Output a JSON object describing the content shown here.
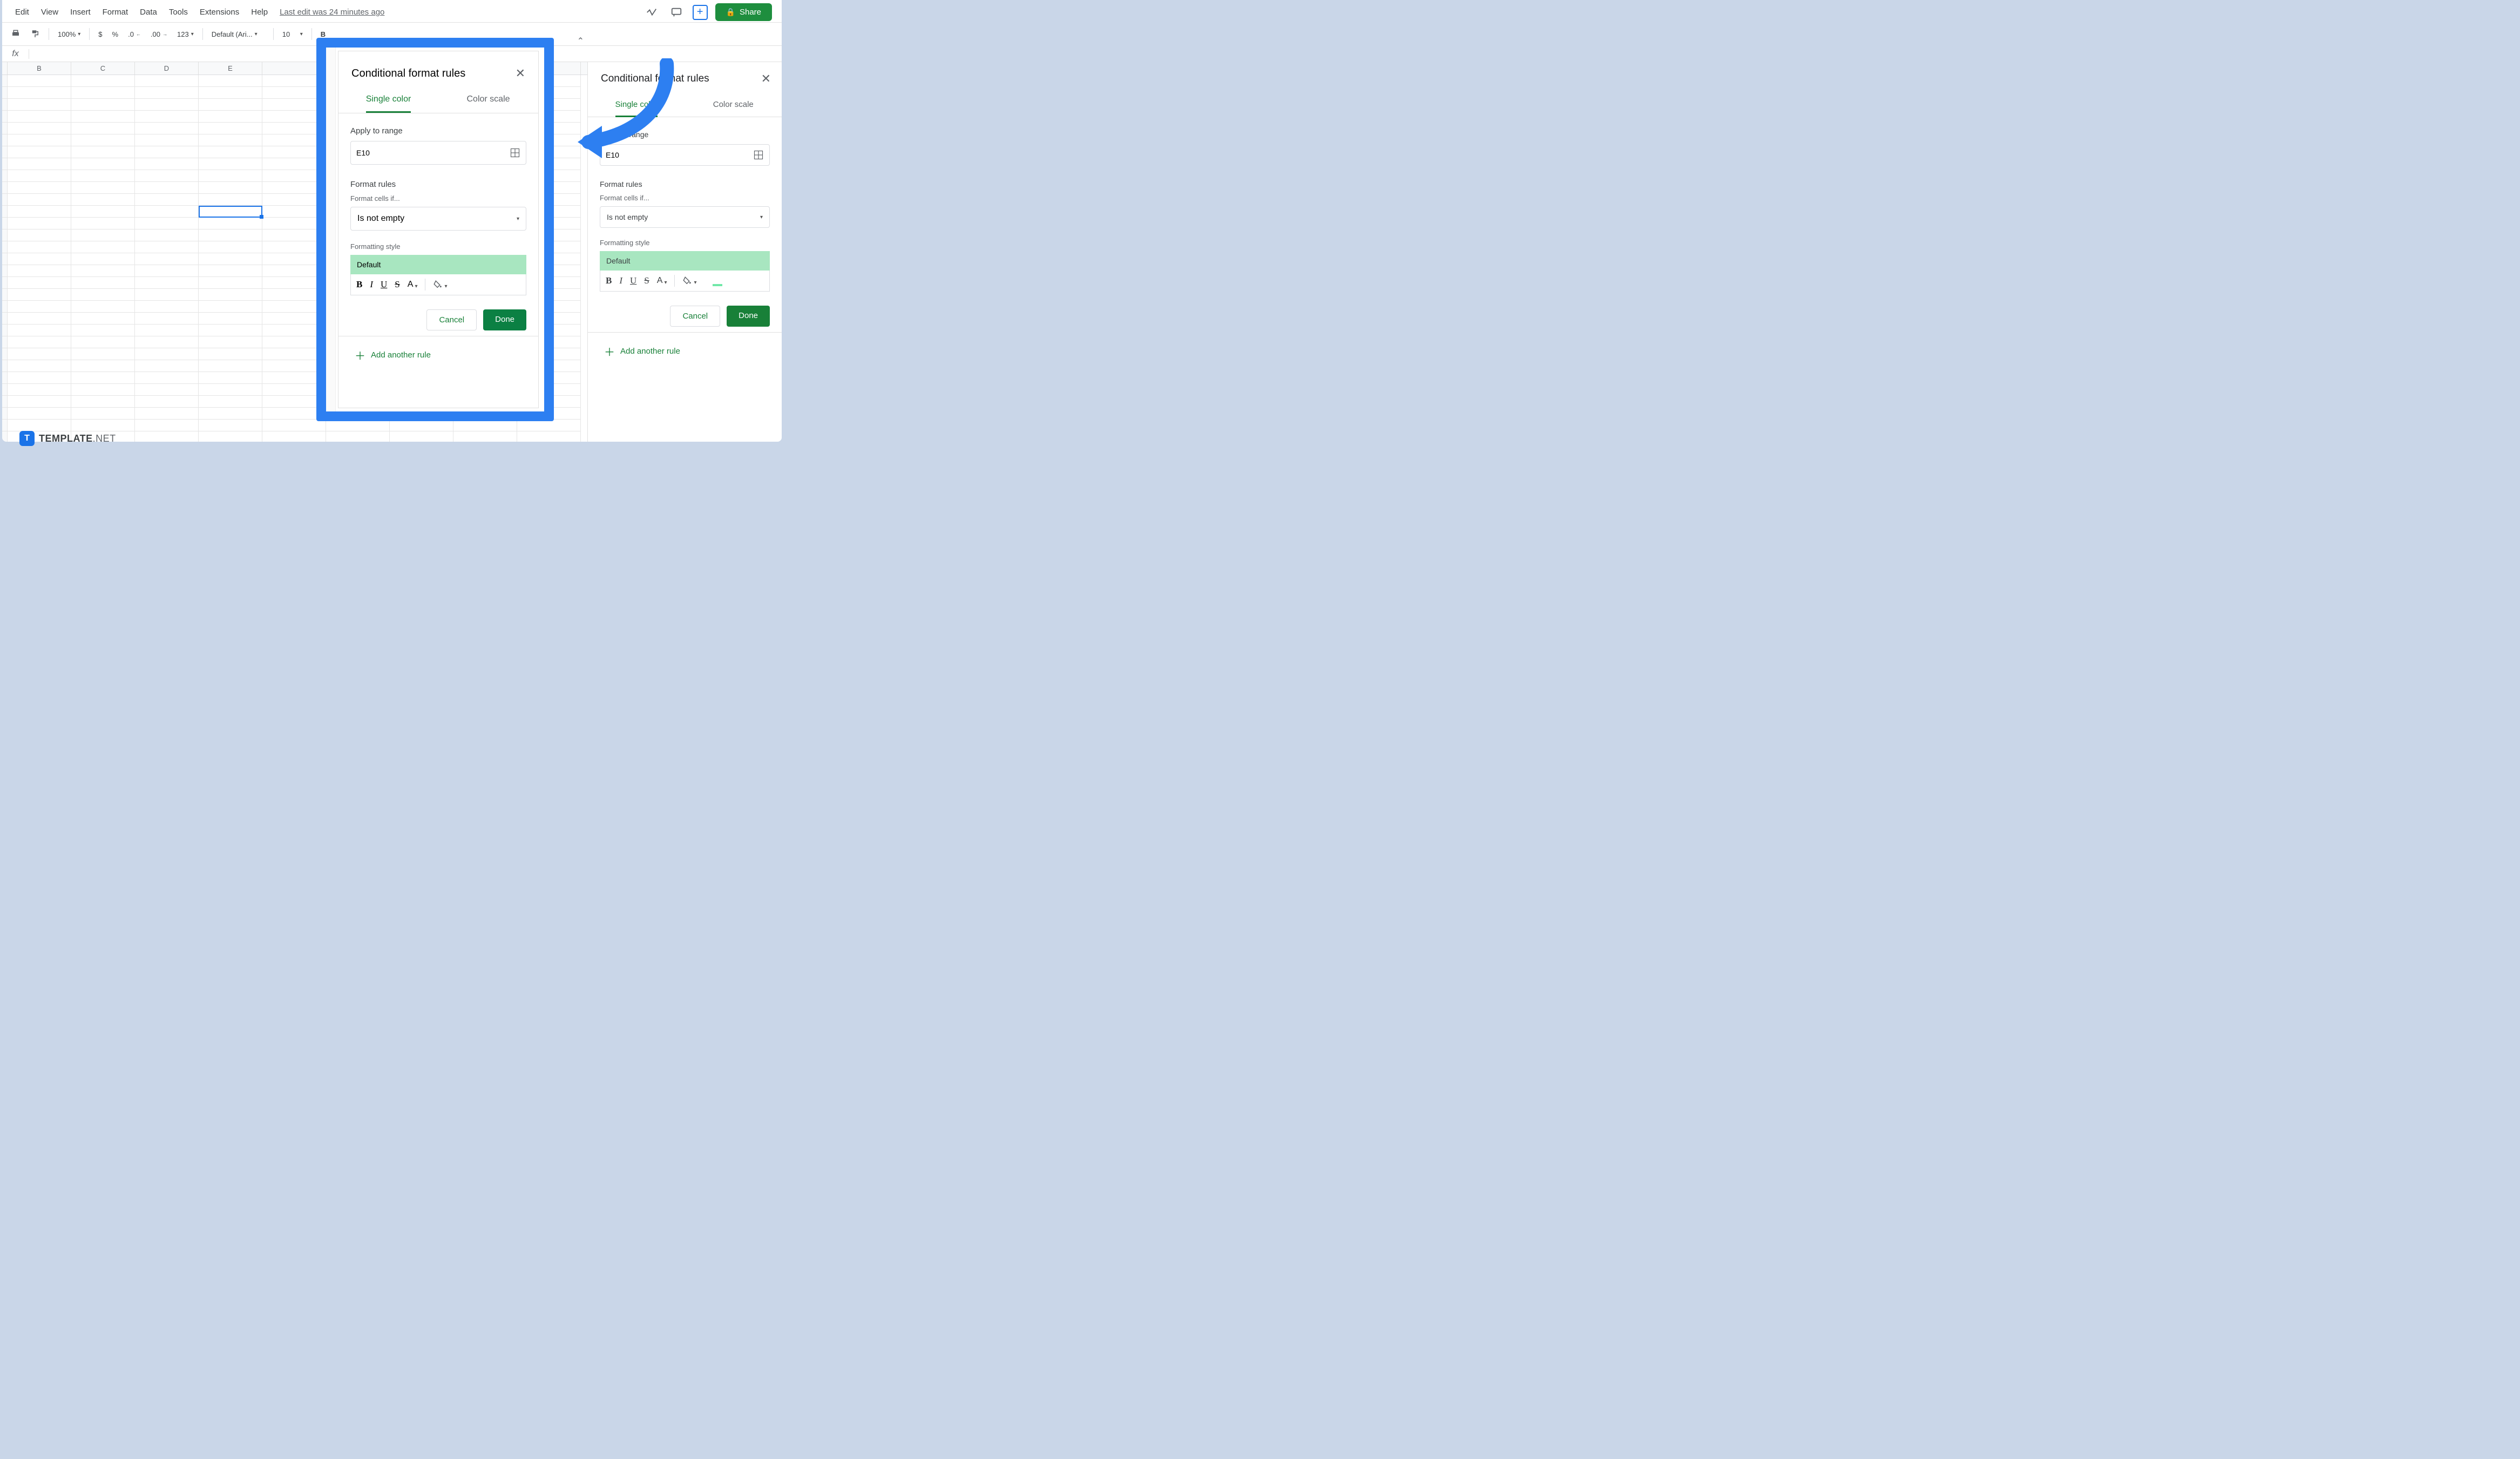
{
  "menu": {
    "edit": "Edit",
    "view": "View",
    "insert": "Insert",
    "format": "Format",
    "data": "Data",
    "tools": "Tools",
    "extensions": "Extensions",
    "help": "Help",
    "last_edit": "Last edit was 24 minutes ago"
  },
  "share": {
    "label": "Share"
  },
  "toolbar": {
    "zoom": "100%",
    "currency": "$",
    "percent": "%",
    "dec_dec": ".0",
    "inc_dec": ".00",
    "num_fmt": "123",
    "font": "Default (Ari...",
    "font_size": "10",
    "bold": "B"
  },
  "formula": {
    "fx": "fx"
  },
  "columns": [
    "B",
    "C",
    "D",
    "E"
  ],
  "panel": {
    "title": "Conditional format rules",
    "tab_single": "Single color",
    "tab_scale": "Color scale",
    "apply_label": "Apply to range",
    "range_value": "E10",
    "format_rules": "Format rules",
    "format_cells_if": "Format cells if...",
    "condition": "Is not empty",
    "formatting_style": "Formatting style",
    "default": "Default",
    "fmt_b": "B",
    "fmt_i": "I",
    "fmt_u": "U",
    "fmt_s": "S",
    "fmt_a": "A",
    "cancel": "Cancel",
    "done": "Done",
    "add_rule": "Add another rule"
  },
  "zoom_panel": {
    "title": "Conditional format rules",
    "tab_single": "Single color",
    "tab_scale": "Color scale",
    "apply_label": "Apply to range",
    "range_value": "E10",
    "format_rules": "Format rules",
    "format_cells_if": "Format cells if...",
    "condition": "Is not empty",
    "formatting_style": "Formatting style",
    "default": "Default",
    "cancel": "Cancel",
    "done": "Done",
    "add_rule": "Add another rule"
  },
  "logo": {
    "t": "T",
    "name": "TEMPLATE",
    "suffix": ".NET"
  }
}
